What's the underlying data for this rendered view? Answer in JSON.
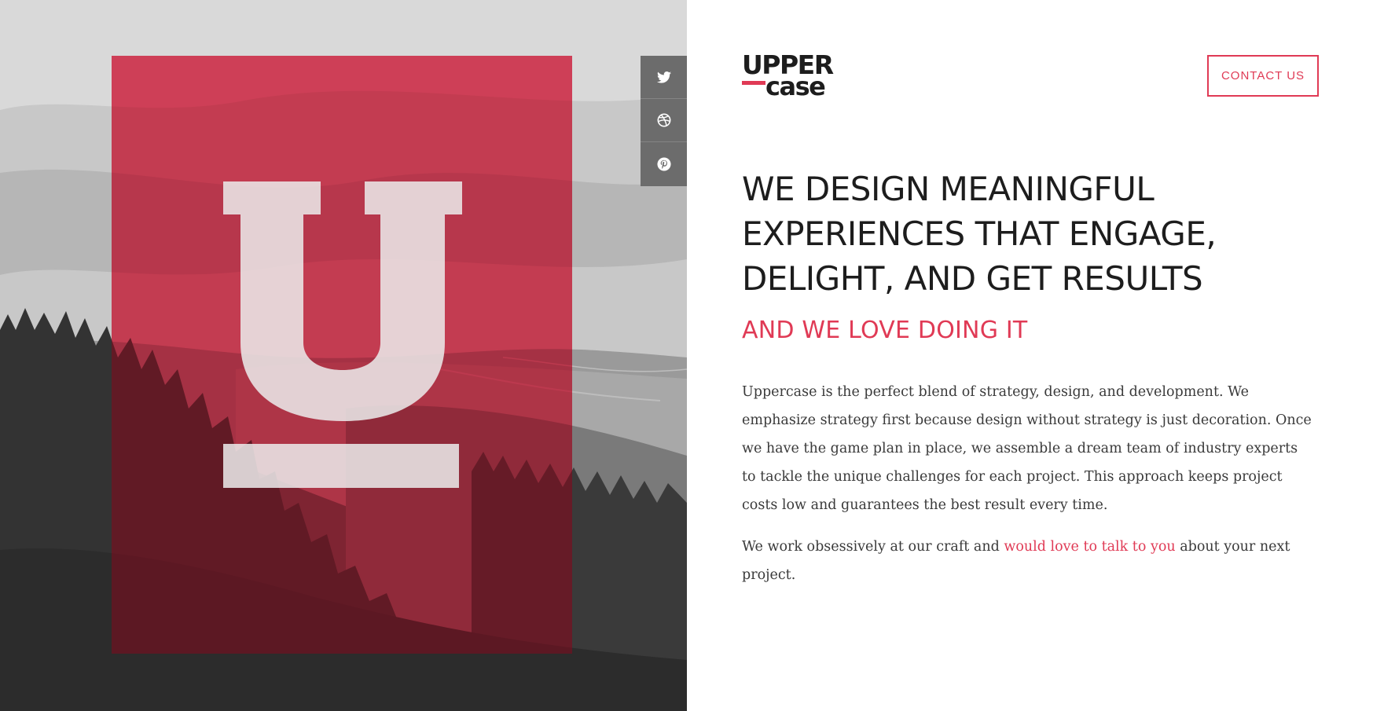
{
  "brand": {
    "upper": "UPPER",
    "lower": "case",
    "accent_color": "#e03a55"
  },
  "header": {
    "contact_label": "CONTACT US"
  },
  "social": [
    {
      "icon": "twitter-icon"
    },
    {
      "icon": "dribbble-icon"
    },
    {
      "icon": "pinterest-icon"
    }
  ],
  "hero": {
    "headline": "WE DESIGN MEANINGFUL EXPERIENCES THAT ENGAGE, DELIGHT, AND GET RESULTS",
    "subhead": "AND WE LOVE DOING IT"
  },
  "body": {
    "paragraph1": "Uppercase is the perfect blend of strategy, design, and development. We emphasize strategy first because design without strategy is just decoration. Once we have the game plan in place, we assemble a dream team of industry experts to tackle the unique challenges for each project. This approach keeps project costs low and guarantees the best result every time.",
    "paragraph2_before": "We work obsessively at our craft and ",
    "paragraph2_link": "would love to talk to you",
    "paragraph2_after": " about your next project."
  }
}
